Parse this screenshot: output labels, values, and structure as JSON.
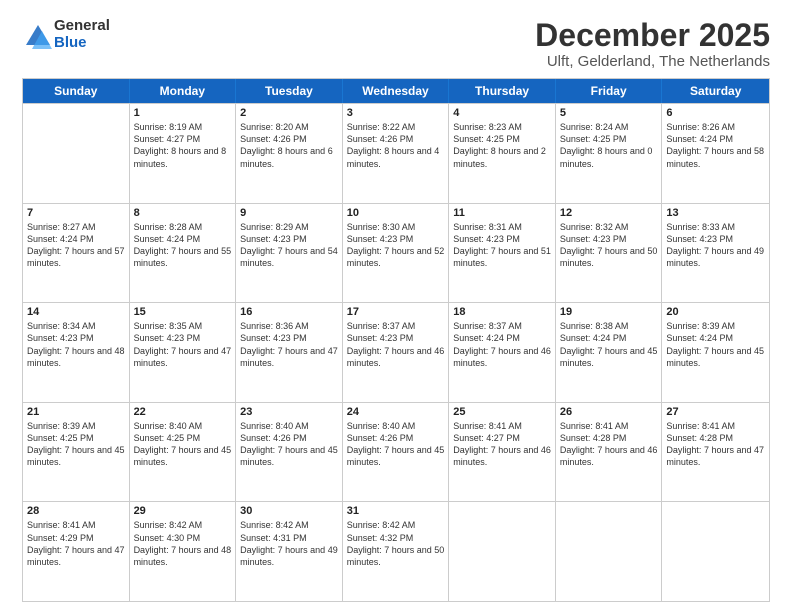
{
  "logo": {
    "general": "General",
    "blue": "Blue"
  },
  "title": "December 2025",
  "location": "Ulft, Gelderland, The Netherlands",
  "header_days": [
    "Sunday",
    "Monday",
    "Tuesday",
    "Wednesday",
    "Thursday",
    "Friday",
    "Saturday"
  ],
  "rows": [
    [
      {
        "day": "",
        "sunrise": "",
        "sunset": "",
        "daylight": ""
      },
      {
        "day": "1",
        "sunrise": "Sunrise: 8:19 AM",
        "sunset": "Sunset: 4:27 PM",
        "daylight": "Daylight: 8 hours and 8 minutes."
      },
      {
        "day": "2",
        "sunrise": "Sunrise: 8:20 AM",
        "sunset": "Sunset: 4:26 PM",
        "daylight": "Daylight: 8 hours and 6 minutes."
      },
      {
        "day": "3",
        "sunrise": "Sunrise: 8:22 AM",
        "sunset": "Sunset: 4:26 PM",
        "daylight": "Daylight: 8 hours and 4 minutes."
      },
      {
        "day": "4",
        "sunrise": "Sunrise: 8:23 AM",
        "sunset": "Sunset: 4:25 PM",
        "daylight": "Daylight: 8 hours and 2 minutes."
      },
      {
        "day": "5",
        "sunrise": "Sunrise: 8:24 AM",
        "sunset": "Sunset: 4:25 PM",
        "daylight": "Daylight: 8 hours and 0 minutes."
      },
      {
        "day": "6",
        "sunrise": "Sunrise: 8:26 AM",
        "sunset": "Sunset: 4:24 PM",
        "daylight": "Daylight: 7 hours and 58 minutes."
      }
    ],
    [
      {
        "day": "7",
        "sunrise": "Sunrise: 8:27 AM",
        "sunset": "Sunset: 4:24 PM",
        "daylight": "Daylight: 7 hours and 57 minutes."
      },
      {
        "day": "8",
        "sunrise": "Sunrise: 8:28 AM",
        "sunset": "Sunset: 4:24 PM",
        "daylight": "Daylight: 7 hours and 55 minutes."
      },
      {
        "day": "9",
        "sunrise": "Sunrise: 8:29 AM",
        "sunset": "Sunset: 4:23 PM",
        "daylight": "Daylight: 7 hours and 54 minutes."
      },
      {
        "day": "10",
        "sunrise": "Sunrise: 8:30 AM",
        "sunset": "Sunset: 4:23 PM",
        "daylight": "Daylight: 7 hours and 52 minutes."
      },
      {
        "day": "11",
        "sunrise": "Sunrise: 8:31 AM",
        "sunset": "Sunset: 4:23 PM",
        "daylight": "Daylight: 7 hours and 51 minutes."
      },
      {
        "day": "12",
        "sunrise": "Sunrise: 8:32 AM",
        "sunset": "Sunset: 4:23 PM",
        "daylight": "Daylight: 7 hours and 50 minutes."
      },
      {
        "day": "13",
        "sunrise": "Sunrise: 8:33 AM",
        "sunset": "Sunset: 4:23 PM",
        "daylight": "Daylight: 7 hours and 49 minutes."
      }
    ],
    [
      {
        "day": "14",
        "sunrise": "Sunrise: 8:34 AM",
        "sunset": "Sunset: 4:23 PM",
        "daylight": "Daylight: 7 hours and 48 minutes."
      },
      {
        "day": "15",
        "sunrise": "Sunrise: 8:35 AM",
        "sunset": "Sunset: 4:23 PM",
        "daylight": "Daylight: 7 hours and 47 minutes."
      },
      {
        "day": "16",
        "sunrise": "Sunrise: 8:36 AM",
        "sunset": "Sunset: 4:23 PM",
        "daylight": "Daylight: 7 hours and 47 minutes."
      },
      {
        "day": "17",
        "sunrise": "Sunrise: 8:37 AM",
        "sunset": "Sunset: 4:23 PM",
        "daylight": "Daylight: 7 hours and 46 minutes."
      },
      {
        "day": "18",
        "sunrise": "Sunrise: 8:37 AM",
        "sunset": "Sunset: 4:24 PM",
        "daylight": "Daylight: 7 hours and 46 minutes."
      },
      {
        "day": "19",
        "sunrise": "Sunrise: 8:38 AM",
        "sunset": "Sunset: 4:24 PM",
        "daylight": "Daylight: 7 hours and 45 minutes."
      },
      {
        "day": "20",
        "sunrise": "Sunrise: 8:39 AM",
        "sunset": "Sunset: 4:24 PM",
        "daylight": "Daylight: 7 hours and 45 minutes."
      }
    ],
    [
      {
        "day": "21",
        "sunrise": "Sunrise: 8:39 AM",
        "sunset": "Sunset: 4:25 PM",
        "daylight": "Daylight: 7 hours and 45 minutes."
      },
      {
        "day": "22",
        "sunrise": "Sunrise: 8:40 AM",
        "sunset": "Sunset: 4:25 PM",
        "daylight": "Daylight: 7 hours and 45 minutes."
      },
      {
        "day": "23",
        "sunrise": "Sunrise: 8:40 AM",
        "sunset": "Sunset: 4:26 PM",
        "daylight": "Daylight: 7 hours and 45 minutes."
      },
      {
        "day": "24",
        "sunrise": "Sunrise: 8:40 AM",
        "sunset": "Sunset: 4:26 PM",
        "daylight": "Daylight: 7 hours and 45 minutes."
      },
      {
        "day": "25",
        "sunrise": "Sunrise: 8:41 AM",
        "sunset": "Sunset: 4:27 PM",
        "daylight": "Daylight: 7 hours and 46 minutes."
      },
      {
        "day": "26",
        "sunrise": "Sunrise: 8:41 AM",
        "sunset": "Sunset: 4:28 PM",
        "daylight": "Daylight: 7 hours and 46 minutes."
      },
      {
        "day": "27",
        "sunrise": "Sunrise: 8:41 AM",
        "sunset": "Sunset: 4:28 PM",
        "daylight": "Daylight: 7 hours and 47 minutes."
      }
    ],
    [
      {
        "day": "28",
        "sunrise": "Sunrise: 8:41 AM",
        "sunset": "Sunset: 4:29 PM",
        "daylight": "Daylight: 7 hours and 47 minutes."
      },
      {
        "day": "29",
        "sunrise": "Sunrise: 8:42 AM",
        "sunset": "Sunset: 4:30 PM",
        "daylight": "Daylight: 7 hours and 48 minutes."
      },
      {
        "day": "30",
        "sunrise": "Sunrise: 8:42 AM",
        "sunset": "Sunset: 4:31 PM",
        "daylight": "Daylight: 7 hours and 49 minutes."
      },
      {
        "day": "31",
        "sunrise": "Sunrise: 8:42 AM",
        "sunset": "Sunset: 4:32 PM",
        "daylight": "Daylight: 7 hours and 50 minutes."
      },
      {
        "day": "",
        "sunrise": "",
        "sunset": "",
        "daylight": ""
      },
      {
        "day": "",
        "sunrise": "",
        "sunset": "",
        "daylight": ""
      },
      {
        "day": "",
        "sunrise": "",
        "sunset": "",
        "daylight": ""
      }
    ]
  ]
}
